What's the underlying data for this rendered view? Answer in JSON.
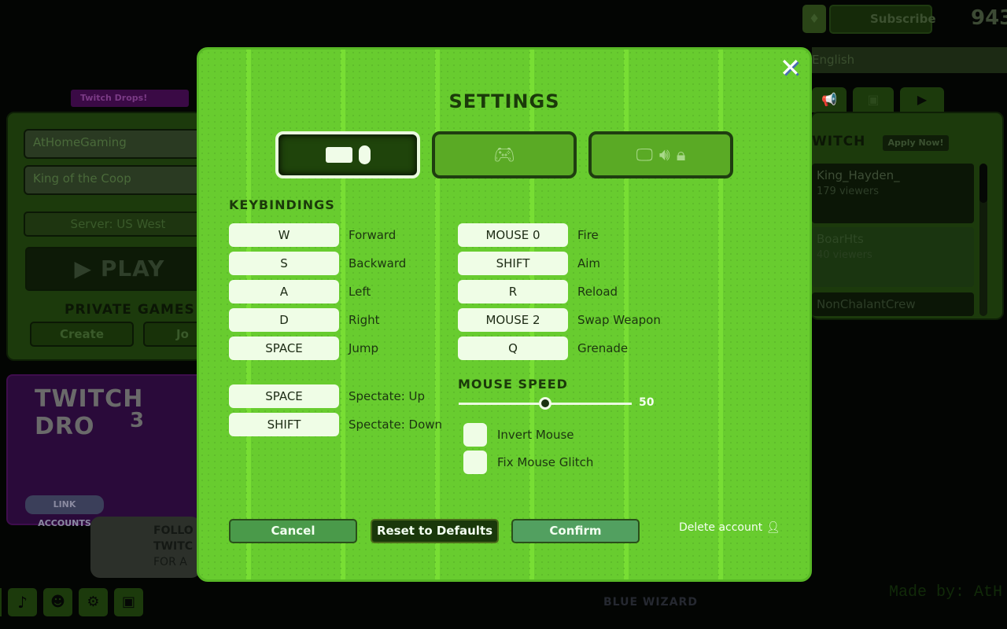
{
  "background": {
    "twitch_drops_badge": "Twitch Drops!",
    "name_field": "AtHomeGaming",
    "game_field": "King of the Coop",
    "server": "Server: US West",
    "play": "PLAY",
    "private_games": "PRIVATE GAMES",
    "create": "Create",
    "join": "Jo",
    "subscribe": "Subscribe",
    "coins": "943",
    "language": "English",
    "twitch_header": "WITCH",
    "apply_now": "Apply Now!",
    "streams": [
      {
        "name": "King_Hayden_",
        "viewers": "179 viewers"
      },
      {
        "name": "BoarHts",
        "viewers": "40 viewers"
      },
      {
        "name": "NonChalantCrew",
        "viewers": ""
      }
    ],
    "promo_title": "TWITCH DRO",
    "promo_number": "3",
    "link_accounts": "LINK ACCOUNTS",
    "tooltip": [
      "FOLLO",
      "TWITC",
      "FOR A"
    ],
    "made_by": "Made by: AtH",
    "logo": "BLUE WIZARD DIGITAL"
  },
  "settings": {
    "title": "SETTINGS",
    "tabs": [
      {
        "icon": "keyboard-mouse-icon",
        "active": true
      },
      {
        "icon": "gamepad-icon",
        "active": false
      },
      {
        "icon": "monitor-sound-lock-icon",
        "active": false
      }
    ],
    "keybindings_title": "KEYBINDINGS",
    "left_bindings": [
      {
        "key": "W",
        "action": "Forward"
      },
      {
        "key": "S",
        "action": "Backward"
      },
      {
        "key": "A",
        "action": "Left"
      },
      {
        "key": "D",
        "action": "Right"
      },
      {
        "key": "SPACE",
        "action": "Jump"
      }
    ],
    "spectate_bindings": [
      {
        "key": "SPACE",
        "action": "Spectate: Up"
      },
      {
        "key": "SHIFT",
        "action": "Spectate: Down"
      }
    ],
    "right_bindings": [
      {
        "key": "MOUSE 0",
        "action": "Fire"
      },
      {
        "key": "SHIFT",
        "action": "Aim"
      },
      {
        "key": "R",
        "action": "Reload"
      },
      {
        "key": "MOUSE 2",
        "action": "Swap Weapon"
      },
      {
        "key": "Q",
        "action": "Grenade"
      }
    ],
    "mouse_speed_title": "MOUSE SPEED",
    "mouse_speed": "50",
    "mouse_speed_fraction": 0.5,
    "invert_mouse": {
      "label": "Invert Mouse",
      "checked": false
    },
    "fix_mouse_glitch": {
      "label": "Fix Mouse Glitch",
      "checked": false
    },
    "cancel": "Cancel",
    "reset": "Reset to Defaults",
    "confirm": "Confirm",
    "delete_account": "Delete account"
  },
  "colors": {
    "modal": "#68cc2f",
    "dark": "#1b3a0a",
    "key_bg": "#effde6"
  }
}
